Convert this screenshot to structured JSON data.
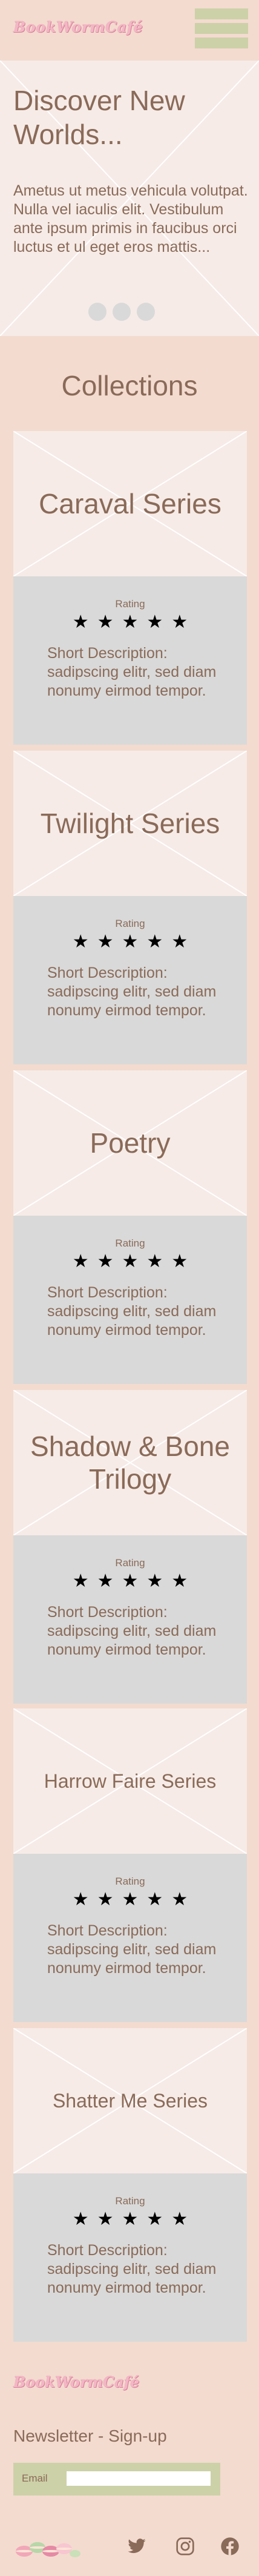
{
  "header": {
    "logo_text": "BookWormCafé",
    "menu_icon": "hamburger-menu-icon"
  },
  "hero": {
    "title": "Discover New Worlds...",
    "text": "Ametus ut metus vehicula volutpat. Nulla vel iaculis elit. Vestibulum ante ipsum primis in faucibus orci luctus et ul eget eros mattis..."
  },
  "collections": {
    "title": "Collections",
    "rating_label": "Rating",
    "stars": "★★★★★",
    "items": [
      {
        "title": "Caraval Series",
        "description": "Short Description: sadipscing elitr, sed diam nonumy eirmod tempor."
      },
      {
        "title": "Twilight Series",
        "description": "Short Description: sadipscing elitr, sed diam nonumy eirmod tempor."
      },
      {
        "title": "Poetry",
        "description": "Short Description: sadipscing elitr, sed diam nonumy eirmod tempor."
      },
      {
        "title": "Shadow & Bone Trilogy",
        "description": "Short Description: sadipscing elitr, sed diam nonumy eirmod tempor."
      },
      {
        "title": "Harrow Faire Series",
        "description": "Short Description: sadipscing elitr, sed diam nonumy eirmod tempor."
      },
      {
        "title": "Shatter Me Series",
        "description": "Short Description: sadipscing elitr, sed diam nonumy eirmod tempor."
      }
    ]
  },
  "footer": {
    "logo_text": "BookWormCafé",
    "newsletter_label": "Newsletter - Sign-up",
    "email_label": "Email",
    "email_value": "",
    "social": [
      "twitter-icon",
      "instagram-icon",
      "facebook-icon"
    ]
  },
  "colors": {
    "background": "#f3dbcf",
    "text": "#8a6a58",
    "accent_green": "#ccd1a8",
    "logo_pink": "#f3b6c5",
    "card_grey": "#d9d9d9"
  }
}
